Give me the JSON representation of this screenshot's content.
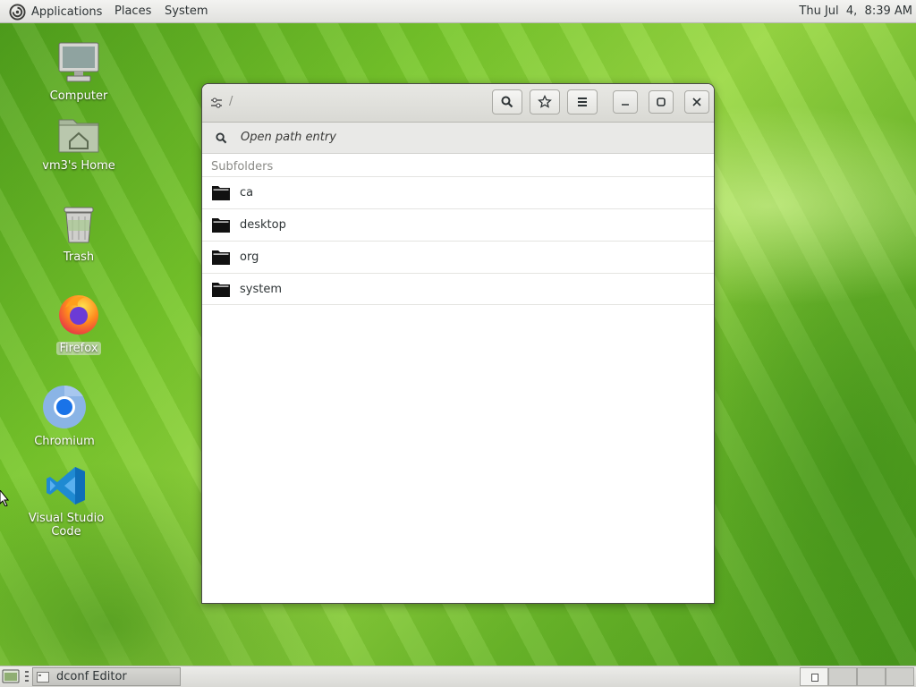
{
  "top_panel": {
    "menus": [
      "Applications",
      "Places",
      "System"
    ],
    "clock": "Thu Jul  4,  8:39 AM"
  },
  "desktop_icons": [
    {
      "label": "Computer",
      "icon": "computer-icon"
    },
    {
      "label": "vm3's Home",
      "icon": "home-folder-icon"
    },
    {
      "label": "Trash",
      "icon": "trash-icon"
    },
    {
      "label": "Firefox",
      "icon": "firefox-icon",
      "selected": true
    },
    {
      "label": "Chromium",
      "icon": "chromium-icon"
    },
    {
      "label": "Visual Studio Code",
      "icon": "vscode-icon"
    }
  ],
  "window": {
    "path": "/",
    "search_placeholder": "Open path entry",
    "section_label": "Subfolders",
    "folders": [
      "ca",
      "desktop",
      "org",
      "system"
    ]
  },
  "taskbar": {
    "task_label": "dconf Editor"
  }
}
